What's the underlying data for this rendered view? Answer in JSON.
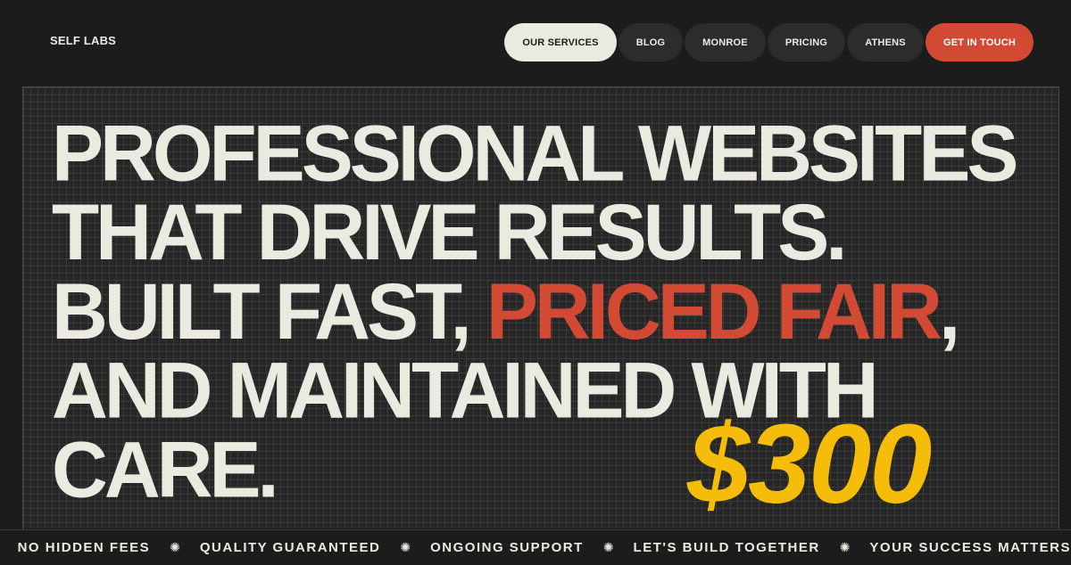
{
  "header": {
    "logo": "SELF LABS",
    "nav": [
      {
        "label": "OUR SERVICES",
        "active": true
      },
      {
        "label": "BLOG"
      },
      {
        "label": "MONROE"
      },
      {
        "label": "PRICING"
      },
      {
        "label": "ATHENS"
      }
    ],
    "cta_label": "GET IN TOUCH"
  },
  "hero": {
    "line1": "PROFESSIONAL WEBSITES",
    "line2": "THAT DRIVE RESULTS.",
    "line3_before": "BUILT FAST, ",
    "line3_accent": "PRICED FAIR",
    "line3_after": ",",
    "line4": "AND MAINTAINED WITH",
    "line5": "CARE.",
    "price": "$300"
  },
  "ticker": {
    "items": [
      "NO HIDDEN FEES",
      "QUALITY GUARANTEED",
      "ONGOING SUPPORT",
      "LET'S BUILD TOGETHER",
      "YOUR SUCCESS MATTERS"
    ],
    "separator_icon": "sun-burst-icon"
  },
  "colors": {
    "background": "#1c1c1c",
    "text": "#ebeae0",
    "accent_red": "#d24a34",
    "price_yellow": "#f5bd0a"
  }
}
